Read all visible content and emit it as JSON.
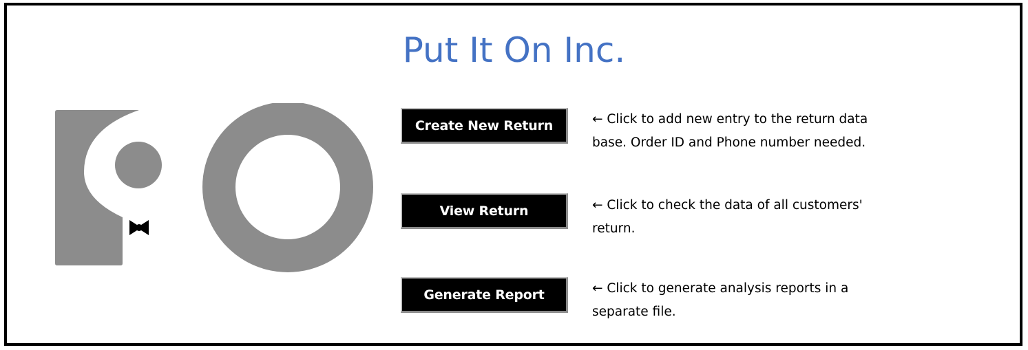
{
  "title": "Put It On Inc.",
  "colors": {
    "title": "#4472c4",
    "logo_gray": "#8c8c8c",
    "button_bg": "#000000",
    "button_text": "#ffffff"
  },
  "actions": [
    {
      "label": "Create New Return",
      "description_lines": [
        "← Click to add new entry to the return data",
        "base. Order ID and Phone number needed."
      ]
    },
    {
      "label": "View Return",
      "description_lines": [
        "← Click to check the data of all customers'",
        "return."
      ]
    },
    {
      "label": "Generate Report",
      "description_lines": [
        "← Click to generate analysis reports in a",
        "separate file."
      ]
    }
  ]
}
